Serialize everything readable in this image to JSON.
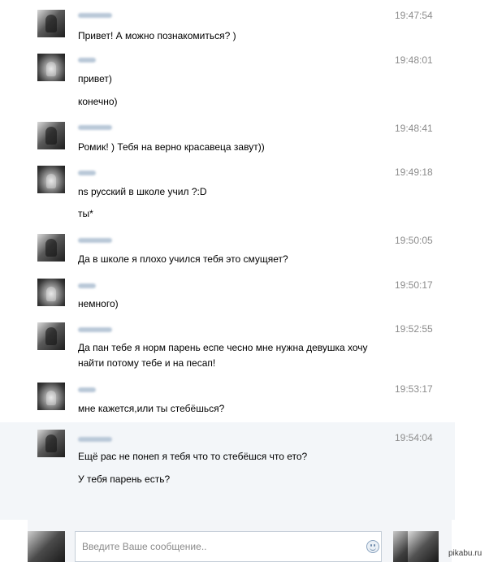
{
  "messages": [
    {
      "time": "19:47:54",
      "lines": [
        "Привет! А можно познакомиться? )"
      ]
    },
    {
      "time": "19:48:01",
      "lines": [
        "привет)",
        "конечно)"
      ]
    },
    {
      "time": "19:48:41",
      "lines": [
        "Ромик! ) Тебя на верно красавеца завут))"
      ]
    },
    {
      "time": "19:49:18",
      "lines": [
        "ns русский в школе учил ?:D",
        "ты*"
      ]
    },
    {
      "time": "19:50:05",
      "lines": [
        "Да в школе я плохо учился тебя это смущяет?"
      ]
    },
    {
      "time": "19:50:17",
      "lines": [
        "немного)"
      ]
    },
    {
      "time": "19:52:55",
      "lines": [
        "Да пан тебе я норм парень еспе чесно мне нужна девушка хочу",
        "найти потому тебе и на песап!"
      ]
    },
    {
      "time": "19:53:17",
      "lines": [
        "мне кажется,или ты стебёшься?"
      ]
    },
    {
      "time": "19:54:04",
      "lines": [
        "Ещё рас не понеп я тебя что то стебёшся что ето?",
        "У тебя парень есть?"
      ]
    }
  ],
  "composer": {
    "placeholder": "Введите Ваше сообщение.."
  },
  "watermark": "pikabu.ru"
}
